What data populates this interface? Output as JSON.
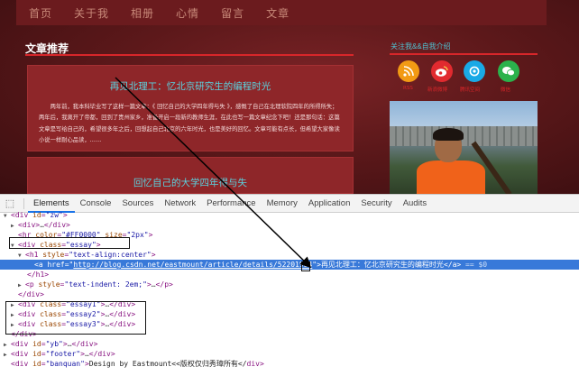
{
  "nav": {
    "items": [
      "首页",
      "关于我",
      "相册",
      "心情",
      "留言",
      "文章"
    ]
  },
  "main": {
    "section_title": "文章推荐",
    "essay1": {
      "title": "再见北理工：忆北京研究生的编程时光",
      "body": "两年前，我本科毕业写了这样一篇文章：《 回忆自己的大学四年得与失 》，感慨了自己在北理软院四年的所得所失；两年后，我离开了帝都，回到了贵州家乡，准备开启一段新的教师生涯，在此也写一篇文章纪念下吧！还是那句话：这篇文章是写给自己的，希望很多年之后，回想起自己北京的六年时光，也是美好的回忆。文章可能有点长，但希望大家像读小说一样耐心品读，……"
    },
    "essay2": {
      "title": "回忆自己的大学四年得与失"
    }
  },
  "sidebar": {
    "title": "关注我&&自我介绍",
    "social": [
      {
        "icon": "rss-icon",
        "label": "RSS",
        "color": "#f29a14"
      },
      {
        "icon": "weibo-icon",
        "label": "新浪微博",
        "color": "#e12a2f"
      },
      {
        "icon": "qzone-icon",
        "label": "腾讯空间",
        "color": "#1aa9e6"
      },
      {
        "icon": "wechat-icon",
        "label": "微信",
        "color": "#2bb24c"
      }
    ]
  },
  "devtools": {
    "tabs": [
      "Elements",
      "Console",
      "Sources",
      "Network",
      "Performance",
      "Memory",
      "Application",
      "Security",
      "Audits"
    ],
    "active_tab": "Elements",
    "tree": {
      "l1_id": "zw",
      "l2_tag": "div",
      "hr_color": "#FF0000",
      "hr_size": "2px",
      "essay_class": "essay",
      "h1_style": "text-align:center",
      "a_href": "http://blog.csdn.net/eastmount/article/details/52201984",
      "a_text": "再见北理工：忆北京研究生的编程时光",
      "a_suffix": "== $0",
      "p_style": "text-indent: 2em;",
      "essay_classes": [
        "essay1",
        "essay2",
        "essay3"
      ],
      "yb_id": "yb",
      "footer_id": "footer",
      "banquan_id": "banquan",
      "banquan_text": "Design by Eastmount<<版权仅归秀璋所有</"
    }
  }
}
